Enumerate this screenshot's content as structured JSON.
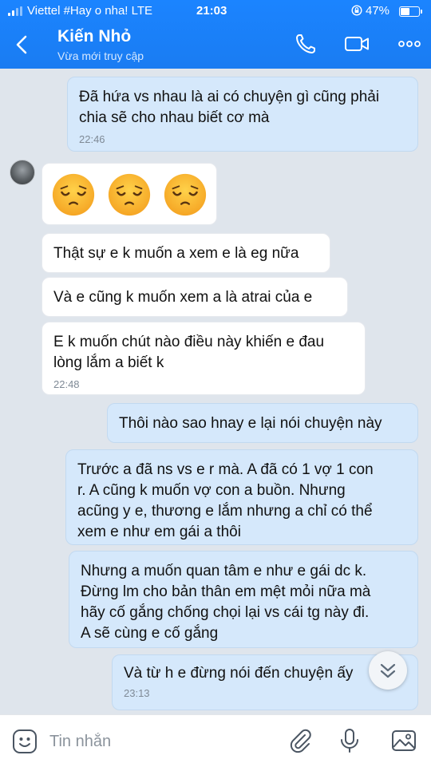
{
  "status_bar": {
    "carrier": "Viettel #Hay o nha!  LTE",
    "time": "21:03",
    "battery": "47%",
    "battery_level": 0.47
  },
  "header": {
    "contact_name": "Kiến Nhỏ",
    "contact_status": "Vừa mới truy cập",
    "icons": [
      "back-icon",
      "phone-icon",
      "video-icon",
      "more-icon"
    ],
    "accent_color": "#1a7cf2"
  },
  "messages": [
    {
      "direction": "out",
      "lines": [
        "Đã hứa vs nhau là ai có chuyện gì cũng phải",
        "chia sẽ cho nhau biết cơ mà"
      ],
      "time": "22:46"
    },
    {
      "direction": "in",
      "emoji": [
        "pleading-face-emoji",
        "pleading-face-emoji",
        "pleading-face-emoji"
      ]
    },
    {
      "direction": "in",
      "lines": [
        "Thật sự e k muốn a xem e là eg nữa"
      ]
    },
    {
      "direction": "in",
      "lines": [
        "Và e cũng k muốn xem a là atrai của e"
      ]
    },
    {
      "direction": "in",
      "lines": [
        "E k muốn chút nào điều này khiến e đau",
        "lòng lắm a biết k"
      ],
      "time": "22:48"
    },
    {
      "direction": "out",
      "lines": [
        "Thôi nào sao hnay e lại nói chuyện này"
      ]
    },
    {
      "direction": "out",
      "lines": [
        "Trước a đã ns vs e r mà. A đã có 1 vợ 1 con",
        "r. A cũng k muốn vợ con a buồn. Nhưng",
        "acũng y e, thương e lắm nhưng a chỉ có thể",
        "xem e như em gái a thôi"
      ]
    },
    {
      "direction": "out",
      "lines": [
        "Nhưng a muốn quan tâm e như e gái dc k.",
        "Đừng lm cho bản thân em mệt mỏi nữa mà",
        "hãy cố gắng chống chọi lại vs cái tg này đi.",
        "A sẽ cùng e cố gắng"
      ]
    },
    {
      "direction": "out",
      "lines": [
        "Và từ h e đừng nói đến chuyện ấy"
      ],
      "time": "23:13"
    }
  ],
  "composer": {
    "placeholder": "Tin nhắn",
    "icons": [
      "sticker-icon",
      "attachment-icon",
      "microphone-icon",
      "image-icon"
    ]
  }
}
